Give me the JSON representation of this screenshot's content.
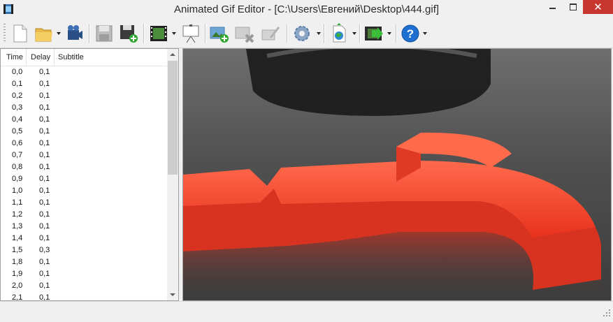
{
  "window": {
    "title": "Animated Gif Editor - [C:\\Users\\Евгений\\Desktop\\444.gif]",
    "controls": {
      "minimize_icon": "minimize-icon",
      "maximize_icon": "maximize-icon",
      "close_glyph": "✕"
    }
  },
  "toolbar": {
    "buttons": [
      {
        "id": "new",
        "icon": "new-document-icon"
      },
      {
        "id": "open",
        "icon": "open-folder-icon",
        "dropdown": true
      },
      {
        "id": "import-video",
        "icon": "video-camera-icon"
      },
      {
        "id": "save",
        "icon": "save-icon"
      },
      {
        "id": "save-as",
        "icon": "save-add-icon"
      },
      {
        "id": "frames",
        "icon": "film-strip-icon",
        "dropdown": true
      },
      {
        "id": "presentation",
        "icon": "presentation-board-icon"
      },
      {
        "id": "add-frame",
        "icon": "add-image-icon"
      },
      {
        "id": "delete-frame",
        "icon": "delete-image-icon"
      },
      {
        "id": "edit-frame",
        "icon": "edit-image-icon"
      },
      {
        "id": "settings",
        "icon": "settings-gear-icon",
        "dropdown": true
      },
      {
        "id": "web-export",
        "icon": "web-export-icon",
        "dropdown": true
      },
      {
        "id": "export-video",
        "icon": "export-film-icon",
        "dropdown": true
      },
      {
        "id": "help",
        "icon": "help-icon",
        "dropdown": true
      }
    ]
  },
  "frame_list": {
    "headers": {
      "time": "Time",
      "delay": "Delay",
      "subtitle": "Subtitle"
    },
    "rows": [
      {
        "time": "0,0",
        "delay": "0,1",
        "subtitle": ""
      },
      {
        "time": "0,1",
        "delay": "0,1",
        "subtitle": ""
      },
      {
        "time": "0,2",
        "delay": "0,1",
        "subtitle": ""
      },
      {
        "time": "0,3",
        "delay": "0,1",
        "subtitle": ""
      },
      {
        "time": "0,4",
        "delay": "0,1",
        "subtitle": ""
      },
      {
        "time": "0,5",
        "delay": "0,1",
        "subtitle": ""
      },
      {
        "time": "0,6",
        "delay": "0,1",
        "subtitle": ""
      },
      {
        "time": "0,7",
        "delay": "0,1",
        "subtitle": ""
      },
      {
        "time": "0,8",
        "delay": "0,1",
        "subtitle": ""
      },
      {
        "time": "0,9",
        "delay": "0,1",
        "subtitle": ""
      },
      {
        "time": "1,0",
        "delay": "0,1",
        "subtitle": ""
      },
      {
        "time": "1,1",
        "delay": "0,1",
        "subtitle": ""
      },
      {
        "time": "1,2",
        "delay": "0,1",
        "subtitle": ""
      },
      {
        "time": "1,3",
        "delay": "0,1",
        "subtitle": ""
      },
      {
        "time": "1,4",
        "delay": "0,1",
        "subtitle": ""
      },
      {
        "time": "1,5",
        "delay": "0,3",
        "subtitle": ""
      },
      {
        "time": "1,8",
        "delay": "0,1",
        "subtitle": ""
      },
      {
        "time": "1,9",
        "delay": "0,1",
        "subtitle": ""
      },
      {
        "time": "2,0",
        "delay": "0,1",
        "subtitle": ""
      },
      {
        "time": "2,1",
        "delay": "0,1",
        "subtitle": ""
      }
    ]
  },
  "preview": {
    "image": "question-mark-render-image",
    "colors": {
      "symbol": "#f5402a",
      "background": "#4a4a4a"
    }
  },
  "statusbar": {
    "text": ""
  }
}
